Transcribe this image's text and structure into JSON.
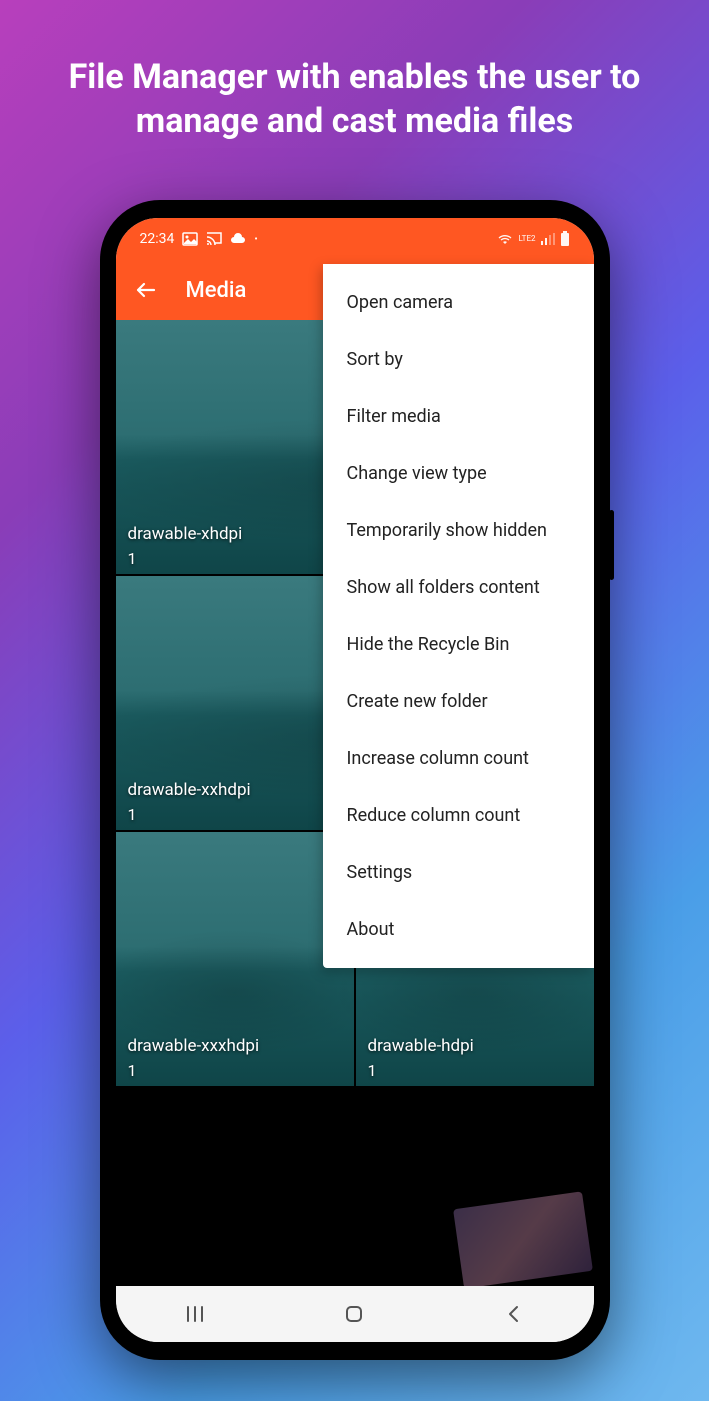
{
  "promo": {
    "headline": "File Manager with enables the user to manage and cast media files"
  },
  "statusBar": {
    "time": "22:34",
    "network": "LTE2"
  },
  "appBar": {
    "title": "Media"
  },
  "folders": [
    {
      "name": "drawable-xhdpi",
      "count": "1"
    },
    {
      "name": "drawable-xxhdpi",
      "count": "1"
    },
    {
      "name": "drawable-xxxhdpi",
      "count": "1"
    },
    {
      "name": "drawable-hdpi",
      "count": "1"
    }
  ],
  "menu": {
    "items": [
      "Open camera",
      "Sort by",
      "Filter media",
      "Change view type",
      "Temporarily show hidden",
      "Show all folders content",
      "Hide the Recycle Bin",
      "Create new folder",
      "Increase column count",
      "Reduce column count",
      "Settings",
      "About"
    ]
  }
}
